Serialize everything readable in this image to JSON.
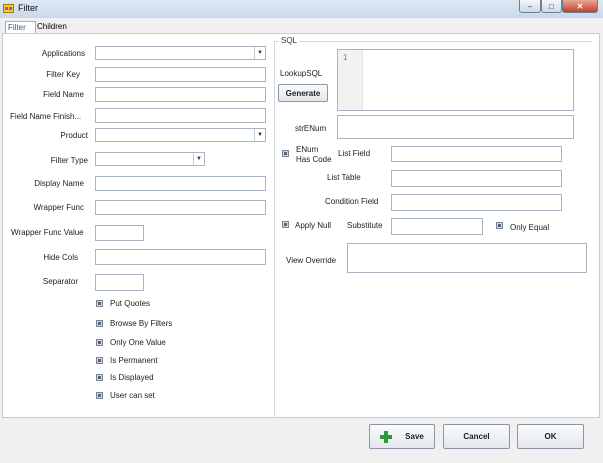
{
  "window": {
    "title": "Filter",
    "minimize_label": "–",
    "maximize_label": "□",
    "close_label": "✕"
  },
  "tabs": [
    {
      "label": "Filter",
      "active": true
    },
    {
      "label": "Children",
      "active": false
    }
  ],
  "left_form": {
    "applications_label": "Applications",
    "filter_key_label": "Filter Key",
    "field_name_label": "Field Name",
    "field_name_finish_label": "Field Name Finish...",
    "product_label": "Product",
    "filter_type_label": "Filter Type",
    "display_name_label": "Display Name",
    "wrapper_func_label": "Wrapper Func",
    "wrapper_func_value_label": "Wrapper Func Value",
    "hide_cols_label": "Hide Cols",
    "separator_label": "Separator",
    "checkboxes": [
      {
        "label": "Put Quotes",
        "checked": false
      },
      {
        "label": "Browse By Filters",
        "checked": false
      },
      {
        "label": "Only One Value",
        "checked": false
      },
      {
        "label": "Is Permanent",
        "checked": false
      },
      {
        "label": "Is Displayed",
        "checked": false
      },
      {
        "label": "User can set",
        "checked": false
      }
    ]
  },
  "sql_group": {
    "title": "SQL",
    "lookup_sql_label": "LookupSQL",
    "line_number": "1",
    "generate_label": "Generate",
    "str_enum_label": "strENum",
    "enum_has_code_label_1": "ENum",
    "enum_has_code_label_2": "Has Code",
    "list_field_label": "List Field",
    "list_table_label": "List Table",
    "condition_field_label": "Condition Field",
    "apply_null_label": "Apply Null",
    "substitute_label": "Substitute",
    "only_equal_label": "Only Equal",
    "view_override_label": "View Override"
  },
  "buttons": {
    "save_label": "Save",
    "cancel_label": "Cancel",
    "ok_label": "OK"
  },
  "colors": {
    "accent_tab": "#2a5aa8",
    "save_icon": "#2d9a37",
    "close_button": "#c0402a"
  }
}
